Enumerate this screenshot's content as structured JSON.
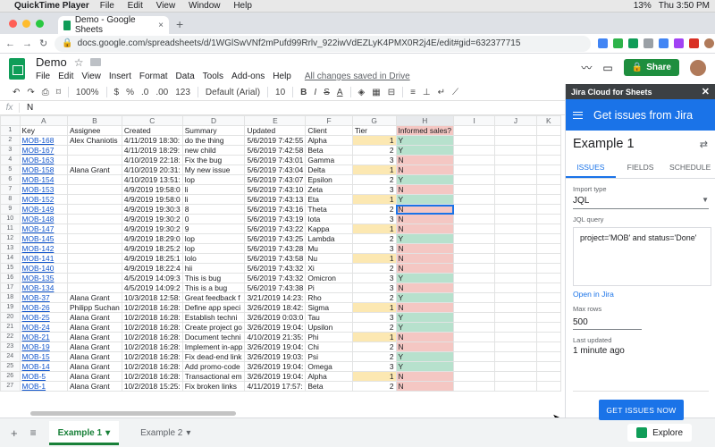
{
  "os_menubar": {
    "apple": "",
    "app_name": "QuickTime Player",
    "menus": [
      "File",
      "Edit",
      "View",
      "Window",
      "Help"
    ],
    "battery": "13%",
    "clock": "Thu 3:50 PM"
  },
  "browser": {
    "tab_title": "Demo - Google Sheets",
    "tab_close": "×",
    "new_tab": "+",
    "url": "docs.google.com/spreadsheets/d/1WGlSwVNf2mPufd99Rrlv_922iwVdEZLyK4PMX0R2j4E/edit#gid=632377715"
  },
  "doc": {
    "title": "Demo",
    "star": "☆",
    "menus": [
      "File",
      "Edit",
      "View",
      "Insert",
      "Format",
      "Data",
      "Tools",
      "Add-ons",
      "Help"
    ],
    "save_status": "All changes saved in Drive",
    "share_label": "Share"
  },
  "toolbar": {
    "zoom": "100%",
    "currency": "$",
    "percent": "%",
    "decimal_down": ".0",
    "decimal_up": ".00",
    "format_more": "123",
    "font": "Default (Arial)",
    "font_size": "10",
    "bold": "B",
    "italic": "I",
    "strike": "S",
    "text_color": "A"
  },
  "formula_bar": {
    "fx": "fx",
    "value": "N"
  },
  "grid": {
    "columns": [
      "A",
      "B",
      "C",
      "D",
      "E",
      "F",
      "G",
      "H",
      "I",
      "J",
      "K"
    ],
    "headers": [
      "Key",
      "Assignee",
      "Created",
      "Summary",
      "Updated",
      "Client",
      "Tier",
      "Informed sales?"
    ],
    "rows": [
      [
        "MOB-168",
        "Alex Chaniotis",
        "4/11/2019 18:30:",
        "do the thing",
        "5/6/2019 7:42:55",
        "Alpha",
        "1",
        "Y"
      ],
      [
        "MOB-167",
        "",
        "4/11/2019 18:29:",
        "new child",
        "5/6/2019 7:42:58",
        "Beta",
        "2",
        "Y"
      ],
      [
        "MOB-163",
        "",
        "4/10/2019 22:18:",
        "Fix the bug",
        "5/6/2019 7:43:01",
        "Gamma",
        "3",
        "N"
      ],
      [
        "MOB-158",
        "Alana Grant",
        "4/10/2019 20:31:",
        "My new issue",
        "5/6/2019 7:43:04",
        "Delta",
        "1",
        "N"
      ],
      [
        "MOB-154",
        "",
        "4/10/2019 13:51:",
        "lop",
        "5/6/2019 7:43:07",
        "Epsilon",
        "2",
        "Y"
      ],
      [
        "MOB-153",
        "",
        "4/9/2019 19:58:0",
        "li",
        "5/6/2019 7:43:10",
        "Zeta",
        "3",
        "N"
      ],
      [
        "MOB-152",
        "",
        "4/9/2019 19:58:0",
        "li",
        "5/6/2019 7:43:13",
        "Eta",
        "1",
        "Y"
      ],
      [
        "MOB-149",
        "",
        "4/9/2019 19:30:3",
        "8",
        "5/6/2019 7:43:16",
        "Theta",
        "2",
        "N"
      ],
      [
        "MOB-148",
        "",
        "4/9/2019 19:30:2",
        "0",
        "5/6/2019 7:43:19",
        "Iota",
        "3",
        "N"
      ],
      [
        "MOB-147",
        "",
        "4/9/2019 19:30:2",
        "9",
        "5/6/2019 7:43:22",
        "Kappa",
        "1",
        "N"
      ],
      [
        "MOB-145",
        "",
        "4/9/2019 18:29:0",
        "lop",
        "5/6/2019 7:43:25",
        "Lambda",
        "2",
        "Y"
      ],
      [
        "MOB-142",
        "",
        "4/9/2019 18:25:2",
        "lop",
        "5/6/2019 7:43:28",
        "Mu",
        "3",
        "N"
      ],
      [
        "MOB-141",
        "",
        "4/9/2019 18:25:1",
        "lolo",
        "5/6/2019 7:43:58",
        "Nu",
        "1",
        "N"
      ],
      [
        "MOB-140",
        "",
        "4/9/2019 18:22:4",
        "hii",
        "5/6/2019 7:43:32",
        "Xi",
        "2",
        "N"
      ],
      [
        "MOB-135",
        "",
        "4/5/2019 14:09:3",
        "This is bug",
        "5/6/2019 7:43:32",
        "Omicron",
        "3",
        "Y"
      ],
      [
        "MOB-134",
        "",
        "4/5/2019 14:09:2",
        "This is a bug",
        "5/6/2019 7:43:38",
        "Pi",
        "3",
        "N"
      ],
      [
        "MOB-37",
        "Alana Grant",
        "10/3/2018 12:58:",
        "Great feedback f",
        "3/21/2019 14:23:",
        "Rho",
        "2",
        "Y"
      ],
      [
        "MOB-26",
        "Philipp Suchan",
        "10/2/2018 16:28:",
        "Define app speci",
        "3/26/2019 18:42:",
        "Sigma",
        "1",
        "N"
      ],
      [
        "MOB-25",
        "Alana Grant",
        "10/2/2018 16:28:",
        "Establish techni",
        "3/26/2019 0:03:0",
        "Tau",
        "3",
        "Y"
      ],
      [
        "MOB-24",
        "Alana Grant",
        "10/2/2018 16:28:",
        "Create project go",
        "3/26/2019 19:04:",
        "Upsilon",
        "2",
        "Y"
      ],
      [
        "MOB-21",
        "Alana Grant",
        "10/2/2018 16:28:",
        "Document techni",
        "4/10/2019 21:35:",
        "Phi",
        "1",
        "N"
      ],
      [
        "MOB-19",
        "Alana Grant",
        "10/2/2018 16:28:",
        "Implement in-app",
        "3/26/2019 19:04:",
        "Chi",
        "2",
        "N"
      ],
      [
        "MOB-15",
        "Alana Grant",
        "10/2/2018 16:28:",
        "Fix dead-end link",
        "3/26/2019 19:03:",
        "Psi",
        "2",
        "Y"
      ],
      [
        "MOB-14",
        "Alana Grant",
        "10/2/2018 16:28:",
        "Add promo-code",
        "3/26/2019 19:04:",
        "Omega",
        "3",
        "Y"
      ],
      [
        "MOB-5",
        "Alana Grant",
        "10/2/2018 16:28:",
        "Transactional em",
        "3/26/2019 19:04:",
        "Alpha",
        "1",
        "N"
      ],
      [
        "MOB-1",
        "Alana Grant",
        "10/2/2018 15:25:",
        "Fix broken links",
        "4/11/2019 17:57:",
        "Beta",
        "2",
        "N"
      ]
    ]
  },
  "sheets": {
    "add": "+",
    "list": "≡",
    "tabs": [
      {
        "label": "Example 1",
        "active": true
      },
      {
        "label": "Example 2",
        "active": false
      }
    ],
    "explore_label": "Explore"
  },
  "panel": {
    "header": "Jira Cloud for Sheets",
    "close": "✕",
    "subtitle": "Get issues from Jira",
    "title": "Example 1",
    "swap_icon": "⇄",
    "tabs": [
      "ISSUES",
      "FIELDS",
      "SCHEDULE"
    ],
    "import_type_label": "Import type",
    "import_type_value": "JQL",
    "jql_label": "JQL query",
    "jql_value": "project='MOB' and status='Done'",
    "open_link": "Open in Jira",
    "max_rows_label": "Max rows",
    "max_rows_value": "500",
    "last_updated_label": "Last updated",
    "last_updated_value": "1 minute ago",
    "button_label": "GET ISSUES NOW"
  },
  "colors": {
    "green_yes": "#b7e1cd",
    "red_no": "#f4c7c3",
    "tier1": "#fce8b2",
    "accent": "#1a73e8",
    "sheets_green": "#0f9d58"
  }
}
